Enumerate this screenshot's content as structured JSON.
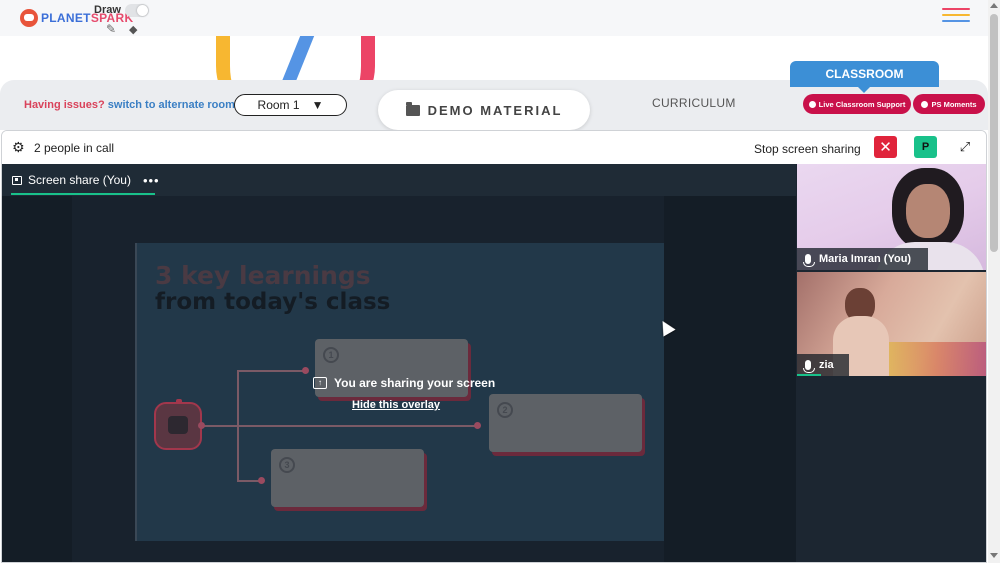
{
  "header": {
    "logo_text_a": "PLANET",
    "logo_text_b": "SPARK",
    "draw_label": "Draw",
    "colors": {
      "brand_blue": "#3b6fd8",
      "brand_pink": "#e64a6c",
      "hamburger": [
        "#ec4466",
        "#f7b731",
        "#5594e4"
      ]
    }
  },
  "roombar": {
    "issues_text": "Having issues?",
    "switch_link": "switch to alternate room",
    "room_selected": "Room 1",
    "room_arrow": "▼",
    "demo_material": "DEMO MATERIAL",
    "curriculum": "CURRICULUM",
    "classroom_tab": "CLASSROOM",
    "live_support": "Live Classroom Support",
    "ps_moments": "PS Moments"
  },
  "call": {
    "people_count": "2 people in call",
    "stop_sharing": "Stop screen sharing",
    "stop_icon": "✕",
    "avatar_initial": "P",
    "expand_icon": "⤢"
  },
  "share": {
    "tab_label": "Screen share (You)",
    "more": "•••",
    "overlay_text": "You are sharing your screen",
    "hide_overlay": "Hide this overlay",
    "slide": {
      "title_line1": "3 key learnings",
      "title_line2": "from today's class",
      "card_numbers": [
        "1",
        "2",
        "3"
      ]
    }
  },
  "participants": [
    {
      "name": "Maria Imran (You)"
    },
    {
      "name": "zia"
    }
  ]
}
